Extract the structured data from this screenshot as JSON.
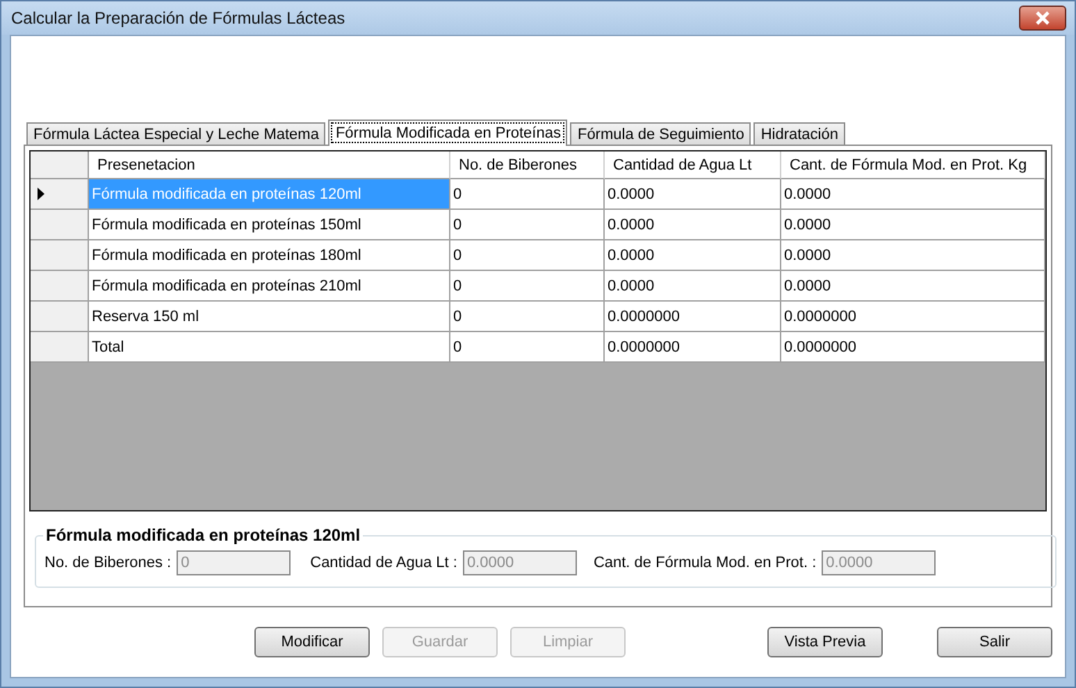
{
  "window": {
    "title": "Calcular la Preparación de Fórmulas Lácteas"
  },
  "tabs": [
    {
      "label": "Fórmula Láctea Especial y Leche Matema",
      "selected": false
    },
    {
      "label": "Fórmula Modificada en Proteínas",
      "selected": true
    },
    {
      "label": "Fórmula de Seguimiento",
      "selected": false
    },
    {
      "label": "Hidratación",
      "selected": false
    }
  ],
  "table": {
    "columns": [
      "Presenetacion",
      "No. de Biberones",
      "Cantidad de Agua Lt",
      "Cant. de Fórmula Mod. en Prot. Kg"
    ],
    "rows": [
      {
        "cells": [
          "Fórmula modificada en proteínas 120ml",
          "0",
          "0.0000",
          "0.0000"
        ],
        "selected": true
      },
      {
        "cells": [
          "Fórmula modificada en proteínas 150ml",
          "0",
          "0.0000",
          "0.0000"
        ],
        "selected": false
      },
      {
        "cells": [
          "Fórmula modificada en proteínas 180ml",
          "0",
          "0.0000",
          "0.0000"
        ],
        "selected": false
      },
      {
        "cells": [
          "Fórmula modificada en proteínas 210ml",
          "0",
          "0.0000",
          "0.0000"
        ],
        "selected": false
      },
      {
        "cells": [
          "Reserva 150 ml",
          "0",
          "0.0000000",
          "0.0000000"
        ],
        "selected": false
      },
      {
        "cells": [
          "Total",
          "0",
          "0.0000000",
          "0.0000000"
        ],
        "selected": false
      }
    ]
  },
  "details": {
    "title": "Fórmula modificada en proteínas 120ml",
    "fields": [
      {
        "label": "No. de Biberones :",
        "value": "0",
        "disabled": true
      },
      {
        "label": "Cantidad de Agua Lt :",
        "value": "0.0000",
        "disabled": true
      },
      {
        "label": "Cant. de Fórmula Mod. en Prot. :",
        "value": "0.0000",
        "disabled": true
      }
    ]
  },
  "buttons": [
    {
      "label": "Modificar",
      "disabled": false
    },
    {
      "label": "Guardar",
      "disabled": true
    },
    {
      "label": "Limpiar",
      "disabled": true
    },
    {
      "label": "Vista Previa",
      "disabled": false
    },
    {
      "label": "Salir",
      "disabled": false
    }
  ]
}
